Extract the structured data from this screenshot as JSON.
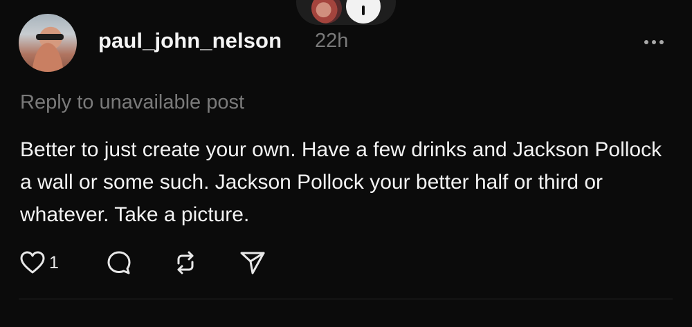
{
  "post": {
    "username": "paul_john_nelson",
    "timestamp": "22h",
    "reply_context": "Reply to unavailable post",
    "body": "Better to just create your own. Have a few drinks and Jackson Pollock a wall or some such. Jackson Pollock your better half or third or whatever. Take a picture.",
    "actions": {
      "like_count": "1",
      "like_icon": "heart-outline-icon",
      "comment_icon": "comment-bubble-icon",
      "repost_icon": "repost-arrows-icon",
      "share_icon": "send-plane-icon"
    },
    "more_icon": "more-horizontal-icon"
  },
  "top_bar": {
    "avatar": "user-avatar",
    "plus_icon": "plus-icon"
  },
  "colors": {
    "background": "#0b0b0b",
    "text_primary": "#f3f3f3",
    "text_secondary": "#7a7a7a",
    "divider": "#2b2b2b"
  }
}
